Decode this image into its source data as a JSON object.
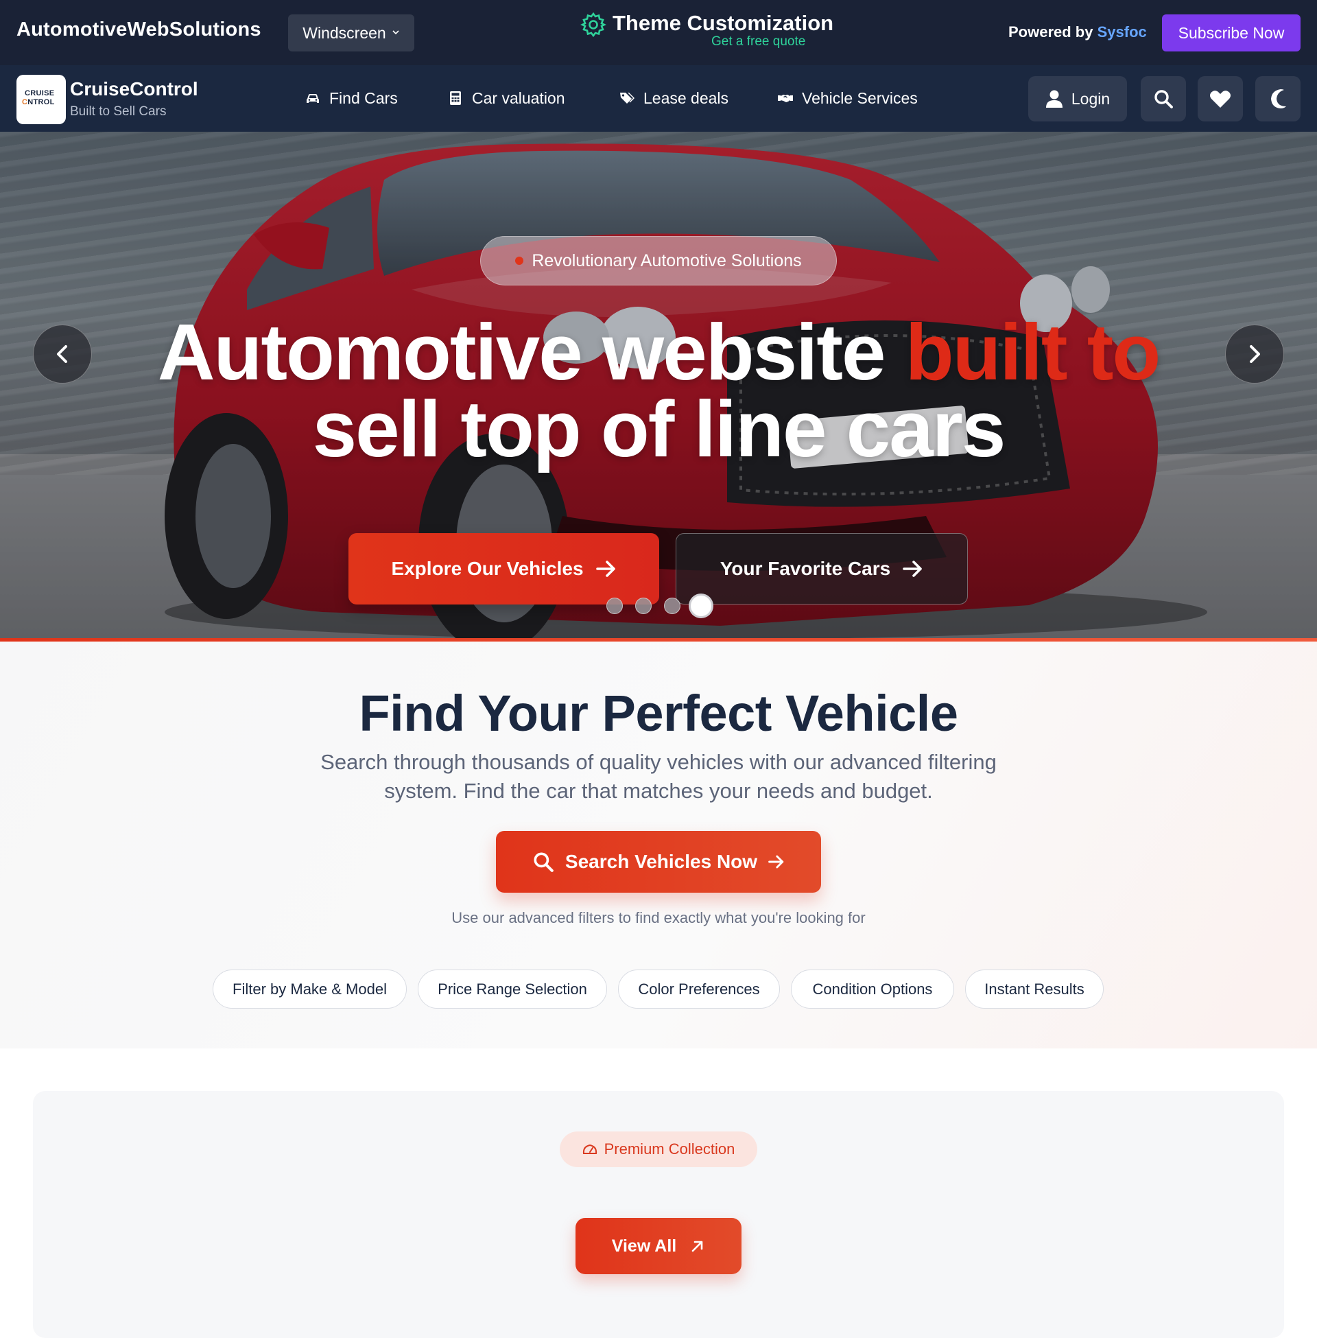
{
  "topbar": {
    "brand": "AutomotiveWebSolutions",
    "theme_select": "Windscreen",
    "customization_title": "Theme Customization",
    "customization_sub": "Get a free quote",
    "powered_prefix": "Powered by",
    "powered_brand": "Sysfoc",
    "subscribe_label": "Subscribe Now"
  },
  "navbar": {
    "logo_line1": "CRUISE",
    "logo_line2a": "C",
    "logo_line2b": "NTR",
    "logo_line2c": "OL",
    "site_name": "CruiseControl",
    "tagline": "Built to Sell Cars",
    "links": [
      {
        "label": "Find Cars",
        "icon": "car-icon"
      },
      {
        "label": "Car valuation",
        "icon": "calculator-icon"
      },
      {
        "label": "Lease deals",
        "icon": "tags-icon"
      },
      {
        "label": "Vehicle Services",
        "icon": "handshake-icon"
      }
    ],
    "login_label": "Login"
  },
  "hero": {
    "badge": "Revolutionary Automotive Solutions",
    "headline_part1": "Automotive website ",
    "headline_accent": "built to",
    "headline_part2": "sell top of line cars",
    "primary_button": "Explore Our Vehicles",
    "secondary_button": "Your Favorite Cars",
    "slides_total": 4,
    "active_slide": 4,
    "accent_color": "#de2a17"
  },
  "search": {
    "title": "Find Your Perfect Vehicle",
    "description": "Search through thousands of quality vehicles with our advanced filtering system. Find the car that matches your needs and budget.",
    "button_label": "Search Vehicles Now",
    "hint": "Use our advanced filters to find exactly what you're looking for",
    "chips": [
      "Filter by Make & Model",
      "Price Range Selection",
      "Color Preferences",
      "Condition Options",
      "Instant Results"
    ]
  },
  "premium": {
    "badge": "Premium Collection",
    "view_all_label": "View All"
  },
  "colors": {
    "topbar_bg": "#1a2236",
    "navbar_bg": "#1b2840",
    "primary_red": "#e0341a",
    "subscribe_purple": "#7c3aed",
    "green_sub": "#2fd39b"
  }
}
